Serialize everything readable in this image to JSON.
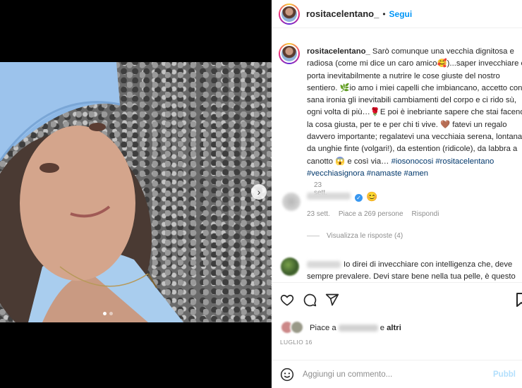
{
  "post": {
    "username": "rositacelentano_",
    "separator": "•",
    "follow_label": "Segui",
    "carousel": {
      "current_index": 1,
      "total": 2
    }
  },
  "caption": {
    "username": "rositacelentano_",
    "text_1": " Sarò comunque una vecchia dignitosa e radiosa (come mi dice un caro amico",
    "emoji_1": "🥰",
    "text_2": ")...saper invecchiare ci porta inevitabilmente a nutrire le cose giuste del nostro sentiero. ",
    "emoji_2": "🌿",
    "text_3": "io amo i miei capelli che imbiancano, accetto con sana ironia gli inevitabili cambiamenti del corpo e ci rido sù, ogni volta di più…",
    "emoji_3": "🌹",
    "text_4": "E poi è inebriante sapere che stai facendo la cosa giusta, per te e per chi ti vive. ",
    "emoji_4": "🤎",
    "text_5": " fatevi un regalo davvero importante; regalatevi una vecchiaia serena, lontana da unghie finte (volgari!), da estention (ridicole), da labbra a canotto ",
    "emoji_5": "😱",
    "text_6": " e così via…",
    "hashtags": "#iosonocosi #rositacelentano #vecchiasignora #namaste #amen",
    "date": "23 sett."
  },
  "comment_2": {
    "emoji": "😊",
    "date": "23 sett.",
    "likes": "Piace a 269 persone",
    "reply": "Rispondi",
    "view_replies": "Visualizza le risposte (4)"
  },
  "comment_3": {
    "text": "Io direi di invecchiare con intelligenza che, deve sempre prevalere. Devi stare bene nella tua pelle, è questo che"
  },
  "likes": {
    "prefix": "Piace a",
    "connector": "e",
    "others": "altri"
  },
  "post_date": "LUGLIO 16",
  "add_comment": {
    "placeholder": "Aggiungi un commento...",
    "publish": "Pubbl"
  },
  "colors": {
    "link_blue": "#0095f6",
    "hashtag_blue": "#00376b",
    "muted_gray": "#8e8e8e",
    "publish_disabled": "#b2dffc"
  }
}
